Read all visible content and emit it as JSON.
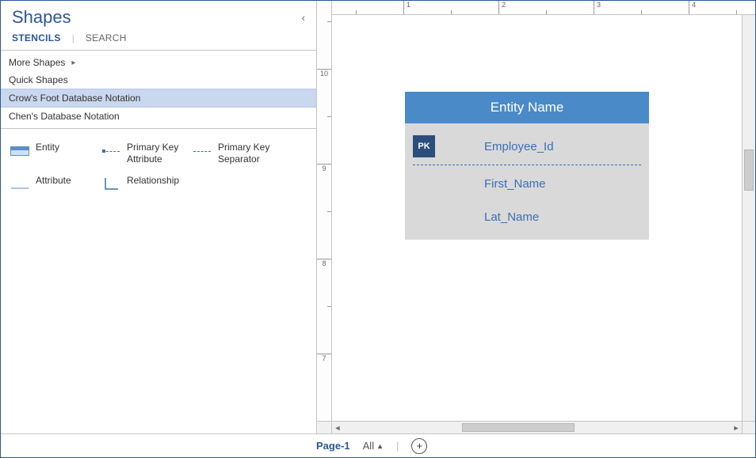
{
  "shapes_pane": {
    "title": "Shapes",
    "tabs": {
      "stencils": "STENCILS",
      "search": "SEARCH"
    },
    "more_shapes": "More Shapes",
    "quick_shapes": "Quick Shapes",
    "stencils": {
      "crows_foot": "Crow's Foot Database Notation",
      "chens": "Chen's Database Notation"
    },
    "items": {
      "entity": "Entity",
      "pk_attr": "Primary Key Attribute",
      "pk_sep": "Primary Key Separator",
      "attribute": "Attribute",
      "relationship": "Relationship"
    }
  },
  "canvas": {
    "entity": {
      "title": "Entity Name",
      "pk_badge": "PK",
      "attributes": {
        "a0": "Employee_Id",
        "a1": "First_Name",
        "a2": "Lat_Name"
      }
    }
  },
  "ruler": {
    "h1": "1",
    "h2": "2",
    "h3": "3",
    "h4": "4",
    "v10": "10",
    "v9": "9",
    "v8": "8",
    "v7": "7"
  },
  "tabs_bar": {
    "page1": "Page-1",
    "all": "All",
    "plus": "+"
  }
}
